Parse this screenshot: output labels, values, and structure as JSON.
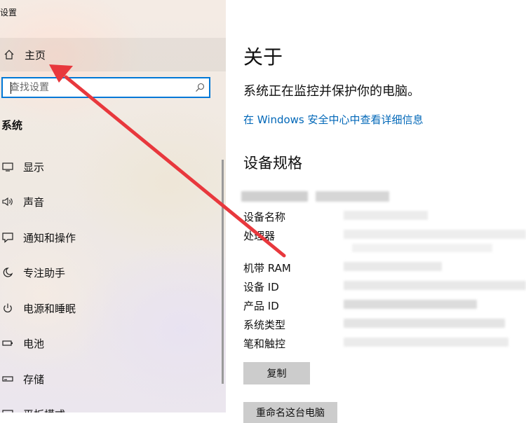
{
  "window": {
    "title": "设置"
  },
  "sidebar": {
    "home_label": "主页",
    "home_icon": "home-icon",
    "search_placeholder": "查找设置",
    "section_title": "系统",
    "items": [
      {
        "label": "显示",
        "icon": "monitor-icon"
      },
      {
        "label": "声音",
        "icon": "speaker-icon"
      },
      {
        "label": "通知和操作",
        "icon": "notification-icon"
      },
      {
        "label": "专注助手",
        "icon": "moon-icon"
      },
      {
        "label": "电源和睡眠",
        "icon": "power-icon"
      },
      {
        "label": "电池",
        "icon": "battery-icon"
      },
      {
        "label": "存储",
        "icon": "storage-icon"
      },
      {
        "label": "平板模式",
        "icon": "tablet-icon"
      }
    ]
  },
  "main": {
    "title": "关于",
    "protect_text": "系统正在监控并保护你的电脑。",
    "security_link": "在 Windows 安全中心中查看详细信息",
    "spec_title": "设备规格",
    "spec_labels": [
      "设备名称",
      "处理器",
      "机带 RAM",
      "设备 ID",
      "产品 ID",
      "系统类型",
      "笔和触控"
    ],
    "copy_button": "复制",
    "rename_button": "重命名这台电脑"
  },
  "colors": {
    "accent": "#0078d7",
    "link": "#0067b8",
    "annotation_arrow": "#e8383d",
    "button_bg": "#cccccc"
  }
}
